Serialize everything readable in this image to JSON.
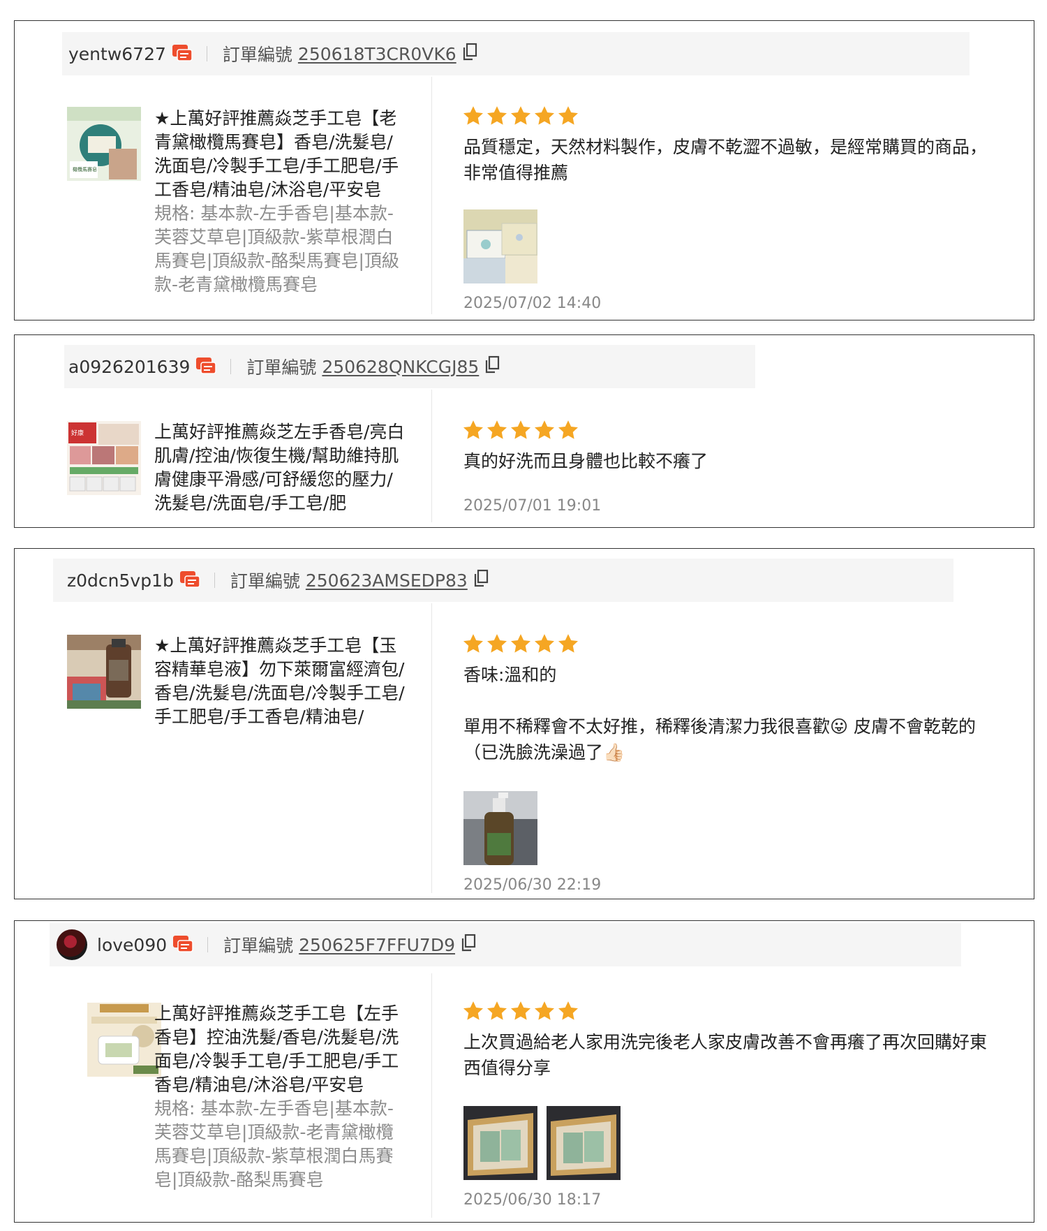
{
  "labels": {
    "order_label": "訂單編號"
  },
  "reviews": [
    {
      "username": "yentw6727",
      "order_number": "250618T3CR0VK6",
      "product_name": "★上萬好評推薦焱芝手工皂【老青黛橄欖馬賽皂】香皂/洗髮皂/洗面皂/冷製手工皂/手工肥皂/手工香皂/精油皂/沐浴皂/平安皂",
      "variation": "規格: 基本款-左手香皂|基本款-芙蓉艾草皂|頂級款-紫草根潤白馬賽皂|頂級款-酪梨馬賽皂|頂級款-老青黛橄欖馬賽皂",
      "rating": 5,
      "comment": "品質穩定，天然材料製作，皮膚不乾澀不過敏，是經常購買的商品，非常值得推薦",
      "date": "2025/07/02 14:40"
    },
    {
      "username": "a0926201639",
      "order_number": "250628QNKCGJ85",
      "product_name": "上萬好評推薦焱芝左手香皂/亮白肌膚/控油/恢復生機/幫助維持肌膚健康平滑感/可舒緩您的壓力/洗髮皂/洗面皂/手工皂/肥",
      "variation": "",
      "rating": 5,
      "comment": "真的好洗而且身體也比較不癢了",
      "date": "2025/07/01 19:01"
    },
    {
      "username": "z0dcn5vp1b",
      "order_number": "250623AMSEDP83",
      "product_name": "★上萬好評推薦焱芝手工皂【玉容精華皂液】勿下萊爾富經濟包/香皂/洗髮皂/洗面皂/冷製手工皂/手工肥皂/手工香皂/精油皂/",
      "variation": "",
      "rating": 5,
      "comment": "香味:溫和的\n\n單用不稀釋會不太好推，稀釋後清潔力我很喜歡😛 皮膚不會乾乾的（已洗臉洗澡過了👍🏻",
      "date": "2025/06/30 22:19"
    },
    {
      "username": "love090",
      "order_number": "250625F7FFU7D9",
      "product_name": "上萬好評推薦焱芝手工皂【左手香皂】控油洗髮/香皂/洗髮皂/洗面皂/冷製手工皂/手工肥皂/手工香皂/精油皂/沐浴皂/平安皂",
      "variation": "規格: 基本款-左手香皂|基本款-芙蓉艾草皂|頂級款-老青黛橄欖馬賽皂|頂級款-紫草根潤白馬賽皂|頂級款-酪梨馬賽皂",
      "rating": 5,
      "comment": "上次買過給老人家用洗完後老人家皮膚改善不會再癢了再次回購好東西值得分享",
      "date": "2025/06/30 18:17"
    }
  ],
  "colors": {
    "star": "#f5a623",
    "chat_icon": "#ee4d2d",
    "border": "#333333",
    "header_bg": "#f5f5f5",
    "date": "#888888"
  }
}
